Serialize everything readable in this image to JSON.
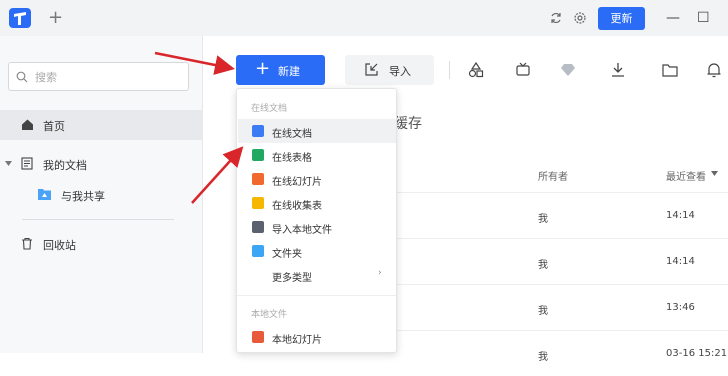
{
  "titlebar": {
    "update_label": "更新",
    "minimize_glyph": "—",
    "maximize_glyph": "☐",
    "tab_add_glyph": "+"
  },
  "sidebar": {
    "search_placeholder": "搜索",
    "items": [
      {
        "label": "首页",
        "icon": "home-icon"
      },
      {
        "label": "我的文档",
        "icon": "document-icon"
      },
      {
        "label": "与我共享",
        "icon": "shared-folder-icon"
      },
      {
        "label": "回收站",
        "icon": "trash-icon"
      }
    ]
  },
  "toolbar": {
    "new_label": "新建",
    "import_label": "导入"
  },
  "main": {
    "section_title_partial": "缓存",
    "columns": {
      "owner": "所有者",
      "recent": "最近查看"
    },
    "rows": [
      {
        "owner": "我",
        "time": "14:14"
      },
      {
        "owner": "我",
        "time": "14:14"
      },
      {
        "owner": "我",
        "time": "13:46"
      },
      {
        "owner": "我",
        "time": "03-16 15:21"
      }
    ]
  },
  "dropdown": {
    "online_header": "在线文档",
    "local_header": "本地文件",
    "online_items": [
      {
        "label": "在线文档",
        "color": "#3b7cf5"
      },
      {
        "label": "在线表格",
        "color": "#22a861"
      },
      {
        "label": "在线幻灯片",
        "color": "#f06a2e"
      },
      {
        "label": "在线收集表",
        "color": "#f5b700"
      },
      {
        "label": "导入本地文件",
        "color": "#5a6270"
      },
      {
        "label": "文件夹",
        "color": "#3aa6f5"
      },
      {
        "label": "更多类型",
        "color": ""
      }
    ],
    "local_items": [
      {
        "label": "本地幻灯片",
        "color": "#e85b3a"
      }
    ],
    "more_arrow": "›"
  },
  "colors": {
    "accent": "#2b6cf6",
    "annotation_arrow": "#d8262b"
  }
}
